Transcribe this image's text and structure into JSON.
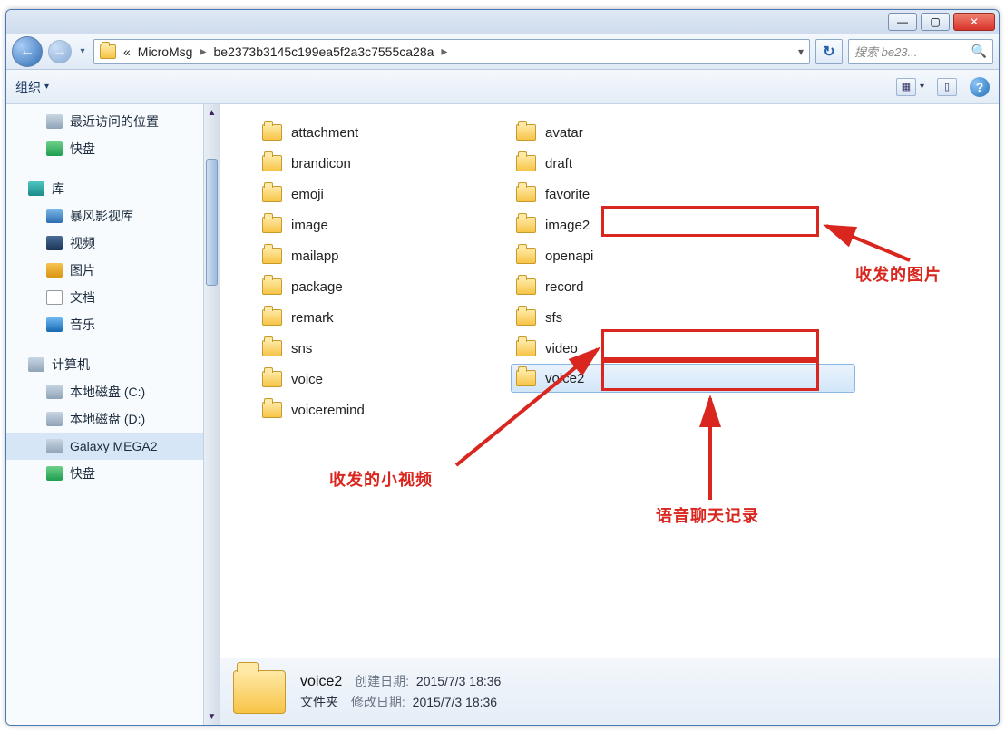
{
  "window_controls": {
    "min": "—",
    "max": "▢",
    "close": "✕"
  },
  "nav": {
    "back_glyph": "←",
    "fwd_glyph": "→",
    "history_drop": "▾"
  },
  "breadcrumb": {
    "prefix": "«",
    "parts": [
      "MicroMsg",
      "be2373b3145c199ea5f2a3c7555ca28a"
    ],
    "sep": "▸",
    "trail_sep": "▸",
    "drop": "▾"
  },
  "refresh_glyph": "↻",
  "search": {
    "placeholder": "搜索 be23...",
    "icon": "🔍"
  },
  "toolbar": {
    "organize": "组织",
    "drop": "▾",
    "view_icon_drop": "▾"
  },
  "sidebar": {
    "items": [
      {
        "label": "最近访问的位置",
        "icon": "drive",
        "indent": true
      },
      {
        "label": "快盘",
        "icon": "green",
        "indent": true
      },
      {
        "spacer": true
      },
      {
        "label": "库",
        "icon": "teal",
        "indent": false
      },
      {
        "label": "暴风影视库",
        "icon": "blue",
        "indent": true
      },
      {
        "label": "视频",
        "icon": "video",
        "indent": true
      },
      {
        "label": "图片",
        "icon": "orange",
        "indent": true
      },
      {
        "label": "文档",
        "icon": "doc",
        "indent": true
      },
      {
        "label": "音乐",
        "icon": "music",
        "indent": true
      },
      {
        "spacer": true
      },
      {
        "label": "计算机",
        "icon": "drive",
        "indent": false
      },
      {
        "label": "本地磁盘 (C:)",
        "icon": "drive",
        "indent": true
      },
      {
        "label": "本地磁盘 (D:)",
        "icon": "drive",
        "indent": true
      },
      {
        "label": "Galaxy MEGA2",
        "icon": "drive",
        "indent": true,
        "selected": true
      },
      {
        "label": "快盘",
        "icon": "green",
        "indent": true
      }
    ]
  },
  "folders": {
    "col1": [
      "attachment",
      "brandicon",
      "emoji",
      "image",
      "mailapp",
      "package",
      "remark",
      "sns",
      "voice",
      "voiceremind"
    ],
    "col2": [
      "avatar",
      "draft",
      "favorite",
      "image2",
      "openapi",
      "record",
      "sfs",
      "video",
      "voice2"
    ],
    "selected": "voice2"
  },
  "annotations": {
    "image2": "收发的图片",
    "video": "收发的小视频",
    "voice2": "语音聊天记录"
  },
  "details": {
    "name": "voice2",
    "type": "文件夹",
    "create_label": "创建日期:",
    "create_value": "2015/7/3 18:36",
    "modify_label": "修改日期:",
    "modify_value": "2015/7/3 18:36"
  }
}
